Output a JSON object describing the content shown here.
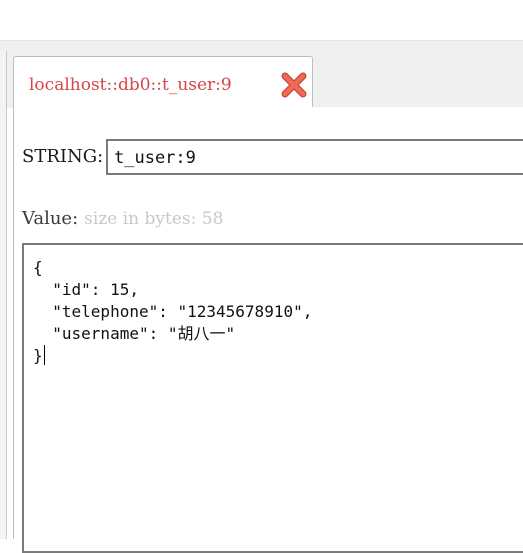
{
  "tab": {
    "title": "localhost::db0::t_user:9",
    "close_icon": "close-x-icon",
    "title_color": "#d64545",
    "close_color": "#e05a4a"
  },
  "key": {
    "type_label": "STRING:",
    "name": "t_user:9"
  },
  "value": {
    "label": "Value:",
    "size_hint": "size in bytes: 58",
    "lines": [
      "{",
      "  \"id\": 15,",
      "  \"telephone\": \"12345678910\",",
      "  \"username\": \"胡八一\"",
      "}"
    ]
  }
}
